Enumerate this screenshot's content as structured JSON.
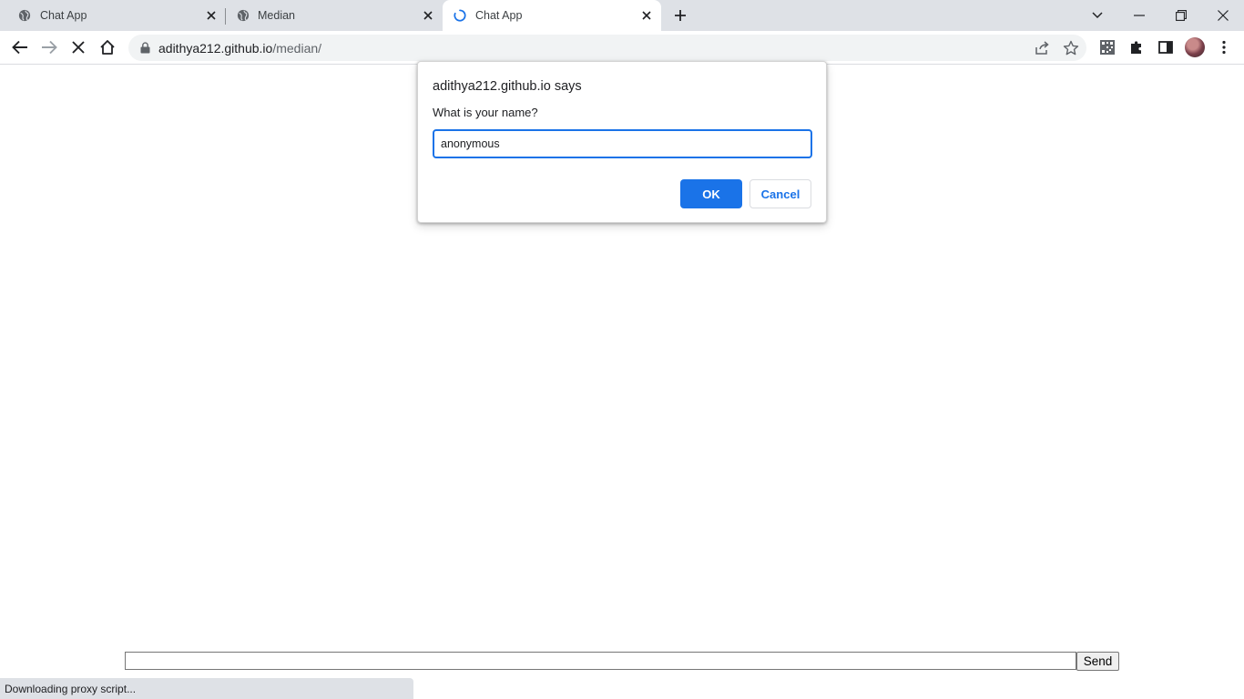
{
  "tabs": [
    {
      "title": "Chat App",
      "icon": "globe-icon",
      "active": false
    },
    {
      "title": "Median",
      "icon": "globe-icon",
      "active": false
    },
    {
      "title": "Chat App",
      "icon": "loading-spinner-icon",
      "active": true
    }
  ],
  "address_bar": {
    "host": "adithya212.github.io",
    "path": "/median/"
  },
  "dialog": {
    "title": "adithya212.github.io says",
    "message": "What is your name?",
    "input_value": "anonymous",
    "ok_label": "OK",
    "cancel_label": "Cancel"
  },
  "page": {
    "send_label": "Send",
    "message_input_value": ""
  },
  "status_bar": {
    "text": "Downloading proxy script..."
  },
  "colors": {
    "accent": "#1a73e8",
    "tabstrip": "#dee1e6",
    "omnibox": "#f1f3f4"
  }
}
